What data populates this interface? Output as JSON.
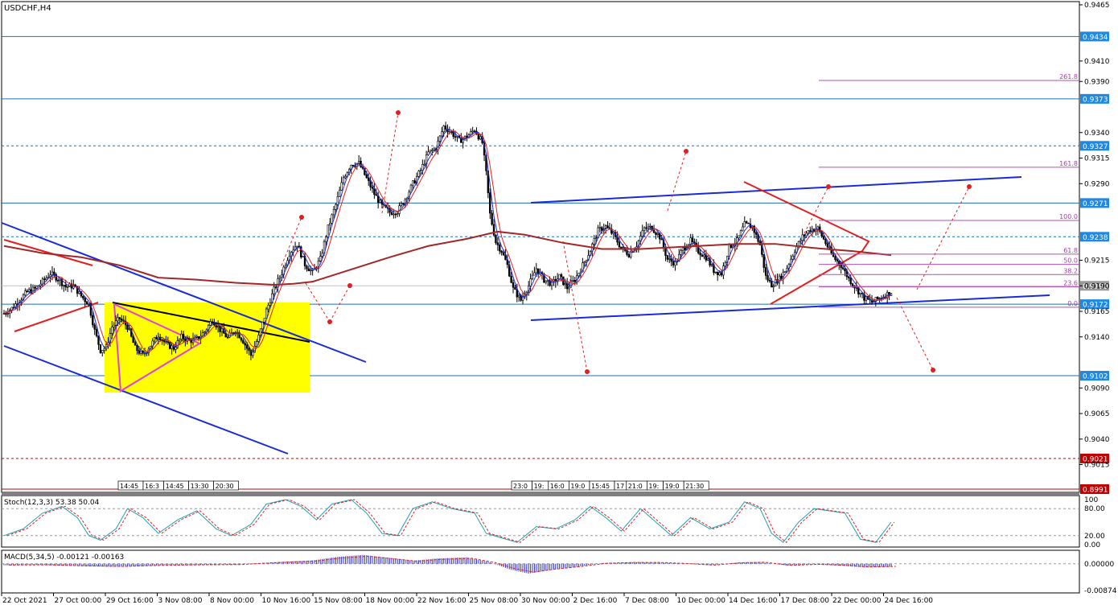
{
  "chart_data": {
    "type": "candlestick",
    "symbol": "USDCHF,H4",
    "y_range": [
      8991,
      9465
    ],
    "price_ticks": [
      "0.9465",
      "0.9410",
      "0.9390",
      "0.9340",
      "0.9315",
      "0.9290",
      "0.9215",
      "0.9190",
      "0.9165",
      "0.9140",
      "0.9090",
      "0.9065",
      "0.9040",
      "0.9015"
    ],
    "x_labels": [
      "22 Oct 2021",
      "27 Oct 00:00",
      "29 Oct 16:00",
      "3 Nov 08:00",
      "8 Nov 00:00",
      "10 Nov 16:00",
      "15 Nov 08:00",
      "18 Nov 00:00",
      "22 Nov 16:00",
      "25 Nov 08:00",
      "30 Nov 00:00",
      "2 Dec 16:00",
      "7 Dec 08:00",
      "10 Dec 00:00",
      "14 Dec 16:00",
      "17 Dec 08:00",
      "22 Dec 00:00",
      "24 Dec 16:00"
    ],
    "levels": [
      {
        "label": "0.9434",
        "value": 9434,
        "style": "solid"
      },
      {
        "label": "0.9373",
        "value": 9373,
        "style": "solid"
      },
      {
        "label": "0.9327",
        "value": 9327,
        "style": "dashed"
      },
      {
        "label": "0.9271",
        "value": 9271,
        "style": "solid"
      },
      {
        "label": "0.9238",
        "value": 9238,
        "style": "dashed"
      },
      {
        "label": "0.9190",
        "value": 9190,
        "style": "solid",
        "color": "#c0c0c0"
      },
      {
        "label": "0.9172",
        "value": 9172,
        "style": "solid"
      },
      {
        "label": "0.9102",
        "value": 9102,
        "style": "solid"
      },
      {
        "label": "0.9021",
        "value": 9021,
        "style": "dashed",
        "color": "#c00000"
      },
      {
        "label": "0.8991",
        "value": 8991,
        "style": "solid",
        "color": "#c00000"
      }
    ],
    "fib_levels": [
      {
        "label": "261.8",
        "value": 9391
      },
      {
        "label": "161.8",
        "value": 9306
      },
      {
        "label": "100.0",
        "value": 9254
      },
      {
        "label": "61.8",
        "value": 9221
      },
      {
        "label": "50.0",
        "value": 9211
      },
      {
        "label": "38.2",
        "value": 9201
      },
      {
        "label": "23.6",
        "value": 9189
      },
      {
        "label": "0.0",
        "value": 9169
      }
    ],
    "time_tags_1": [
      "14:45",
      "16:3",
      "14:45",
      "13:30",
      "20:30"
    ],
    "time_tags_2": [
      "23:0",
      "19:",
      "16:0",
      "19:0",
      "15:45",
      "17",
      "21:0",
      "19:",
      "19:0",
      "21:30"
    ],
    "close_path": [
      [
        0,
        9163
      ],
      [
        4,
        9168
      ],
      [
        8,
        9176
      ],
      [
        12,
        9184
      ],
      [
        16,
        9187
      ],
      [
        20,
        9194
      ],
      [
        24,
        9202
      ],
      [
        28,
        9197
      ],
      [
        32,
        9189
      ],
      [
        36,
        9190
      ],
      [
        40,
        9180
      ],
      [
        44,
        9172
      ],
      [
        47,
        9146
      ],
      [
        50,
        9127
      ],
      [
        53,
        9130
      ],
      [
        56,
        9150
      ],
      [
        60,
        9158
      ],
      [
        64,
        9150
      ],
      [
        68,
        9129
      ],
      [
        72,
        9122
      ],
      [
        76,
        9132
      ],
      [
        80,
        9142
      ],
      [
        84,
        9133
      ],
      [
        88,
        9129
      ],
      [
        92,
        9140
      ],
      [
        96,
        9136
      ],
      [
        100,
        9138
      ],
      [
        104,
        9145
      ],
      [
        108,
        9157
      ],
      [
        112,
        9147
      ],
      [
        116,
        9139
      ],
      [
        120,
        9147
      ],
      [
        124,
        9136
      ],
      [
        128,
        9122
      ],
      [
        132,
        9140
      ],
      [
        136,
        9166
      ],
      [
        140,
        9186
      ],
      [
        144,
        9203
      ],
      [
        148,
        9222
      ],
      [
        152,
        9231
      ],
      [
        156,
        9211
      ],
      [
        160,
        9203
      ],
      [
        164,
        9216
      ],
      [
        168,
        9247
      ],
      [
        172,
        9269
      ],
      [
        176,
        9296
      ],
      [
        180,
        9309
      ],
      [
        184,
        9310
      ],
      [
        188,
        9295
      ],
      [
        192,
        9280
      ],
      [
        196,
        9268
      ],
      [
        200,
        9262
      ],
      [
        204,
        9263
      ],
      [
        208,
        9275
      ],
      [
        212,
        9290
      ],
      [
        216,
        9303
      ],
      [
        220,
        9320
      ],
      [
        224,
        9325
      ],
      [
        228,
        9346
      ],
      [
        232,
        9340
      ],
      [
        236,
        9332
      ],
      [
        240,
        9336
      ],
      [
        244,
        9343
      ],
      [
        248,
        9330
      ],
      [
        250,
        9300
      ],
      [
        252,
        9260
      ],
      [
        255,
        9233
      ],
      [
        258,
        9224
      ],
      [
        261,
        9210
      ],
      [
        264,
        9187
      ],
      [
        268,
        9176
      ],
      [
        272,
        9190
      ],
      [
        276,
        9207
      ],
      [
        280,
        9196
      ],
      [
        284,
        9192
      ],
      [
        288,
        9199
      ],
      [
        292,
        9188
      ],
      [
        296,
        9196
      ],
      [
        300,
        9210
      ],
      [
        304,
        9225
      ],
      [
        308,
        9244
      ],
      [
        312,
        9248
      ],
      [
        316,
        9240
      ],
      [
        320,
        9227
      ],
      [
        324,
        9221
      ],
      [
        328,
        9230
      ],
      [
        332,
        9246
      ],
      [
        336,
        9247
      ],
      [
        340,
        9238
      ],
      [
        344,
        9216
      ],
      [
        348,
        9212
      ],
      [
        352,
        9226
      ],
      [
        356,
        9234
      ],
      [
        360,
        9224
      ],
      [
        364,
        9218
      ],
      [
        368,
        9205
      ],
      [
        372,
        9202
      ],
      [
        376,
        9228
      ],
      [
        380,
        9234
      ],
      [
        384,
        9250
      ],
      [
        388,
        9248
      ],
      [
        392,
        9230
      ],
      [
        395,
        9199
      ],
      [
        398,
        9191
      ],
      [
        402,
        9197
      ],
      [
        406,
        9208
      ],
      [
        410,
        9225
      ],
      [
        414,
        9238
      ],
      [
        418,
        9245
      ],
      [
        422,
        9246
      ],
      [
        426,
        9232
      ],
      [
        430,
        9218
      ],
      [
        434,
        9210
      ],
      [
        438,
        9197
      ],
      [
        442,
        9187
      ],
      [
        446,
        9178
      ],
      [
        450,
        9174
      ],
      [
        454,
        9178
      ],
      [
        458,
        9182
      ],
      [
        460,
        9184
      ]
    ],
    "ma_slow": [
      [
        0,
        9229
      ],
      [
        20,
        9222
      ],
      [
        40,
        9218
      ],
      [
        60,
        9210
      ],
      [
        80,
        9198
      ],
      [
        100,
        9196
      ],
      [
        120,
        9193
      ],
      [
        140,
        9191
      ],
      [
        150,
        9192
      ],
      [
        160,
        9194
      ],
      [
        180,
        9206
      ],
      [
        200,
        9218
      ],
      [
        220,
        9229
      ],
      [
        240,
        9236
      ],
      [
        256,
        9243
      ],
      [
        270,
        9240
      ],
      [
        290,
        9232
      ],
      [
        310,
        9226
      ],
      [
        330,
        9226
      ],
      [
        350,
        9228
      ],
      [
        380,
        9231
      ],
      [
        400,
        9231
      ],
      [
        420,
        9227
      ],
      [
        440,
        9224
      ],
      [
        460,
        9220
      ]
    ],
    "stoch": {
      "label": "Stoch(12,3,3) 53.38 50.04",
      "ticks": [
        "100",
        "80.00",
        "20.00",
        "0.00"
      ],
      "range": [
        0,
        100
      ],
      "values": [
        [
          0,
          20
        ],
        [
          10,
          35
        ],
        [
          20,
          70
        ],
        [
          30,
          85
        ],
        [
          38,
          60
        ],
        [
          44,
          20
        ],
        [
          50,
          10
        ],
        [
          58,
          35
        ],
        [
          64,
          80
        ],
        [
          72,
          60
        ],
        [
          80,
          25
        ],
        [
          90,
          55
        ],
        [
          100,
          75
        ],
        [
          110,
          35
        ],
        [
          118,
          20
        ],
        [
          128,
          45
        ],
        [
          136,
          90
        ],
        [
          146,
          100
        ],
        [
          154,
          85
        ],
        [
          162,
          55
        ],
        [
          170,
          90
        ],
        [
          180,
          100
        ],
        [
          188,
          70
        ],
        [
          196,
          25
        ],
        [
          204,
          20
        ],
        [
          212,
          80
        ],
        [
          222,
          95
        ],
        [
          232,
          80
        ],
        [
          244,
          70
        ],
        [
          250,
          25
        ],
        [
          258,
          15
        ],
        [
          266,
          5
        ],
        [
          276,
          40
        ],
        [
          286,
          35
        ],
        [
          296,
          55
        ],
        [
          304,
          85
        ],
        [
          312,
          60
        ],
        [
          320,
          30
        ],
        [
          330,
          80
        ],
        [
          338,
          50
        ],
        [
          346,
          20
        ],
        [
          356,
          60
        ],
        [
          366,
          35
        ],
        [
          376,
          50
        ],
        [
          384,
          95
        ],
        [
          392,
          80
        ],
        [
          398,
          25
        ],
        [
          404,
          5
        ],
        [
          412,
          50
        ],
        [
          420,
          80
        ],
        [
          428,
          75
        ],
        [
          436,
          70
        ],
        [
          444,
          12
        ],
        [
          452,
          5
        ],
        [
          460,
          50
        ]
      ]
    },
    "macd": {
      "label": "MACD(5,34,5) -0.00121 -0.00163",
      "ticks": [
        "0.00000",
        "-0.00874"
      ],
      "range": [
        -0.00874,
        0.0031
      ],
      "values": [
        [
          0,
          -0.0005
        ],
        [
          20,
          -0.0004
        ],
        [
          40,
          -0.0008
        ],
        [
          60,
          -0.001
        ],
        [
          80,
          -0.0006
        ],
        [
          100,
          -0.0004
        ],
        [
          120,
          -0.0003
        ],
        [
          140,
          0.0005
        ],
        [
          160,
          0.0011
        ],
        [
          172,
          0.0022
        ],
        [
          186,
          0.0029
        ],
        [
          200,
          0.0019
        ],
        [
          212,
          0.001
        ],
        [
          224,
          0.0017
        ],
        [
          240,
          0.0021
        ],
        [
          252,
          0.0005
        ],
        [
          262,
          -0.0018
        ],
        [
          272,
          -0.0032
        ],
        [
          284,
          -0.002
        ],
        [
          296,
          -0.0011
        ],
        [
          310,
          0.0002
        ],
        [
          324,
          0.0005
        ],
        [
          338,
          0.0005
        ],
        [
          352,
          0.0001
        ],
        [
          366,
          -0.0005
        ],
        [
          380,
          0.0004
        ],
        [
          392,
          0.0006
        ],
        [
          406,
          -0.0006
        ],
        [
          420,
          -0.0002
        ],
        [
          434,
          -0.0006
        ],
        [
          446,
          -0.0012
        ],
        [
          460,
          -0.001
        ]
      ]
    }
  }
}
